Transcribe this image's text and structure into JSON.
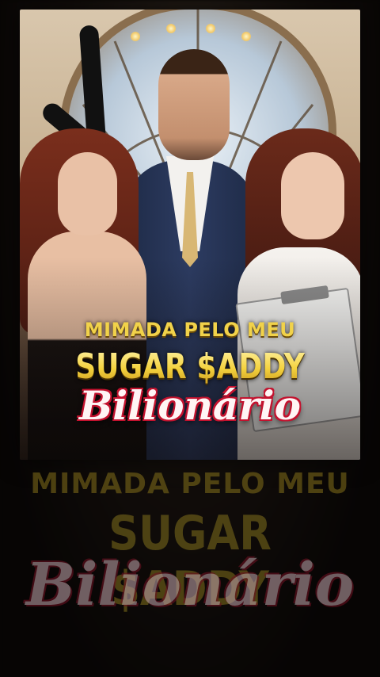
{
  "poster": {
    "title_line1": "MIMADA PELO MEU",
    "title_line2": "SUGAR $ADDY",
    "title_line3": "Bilionário"
  },
  "background_echo": {
    "line1": "MIMADA PELO MEU",
    "line2": "SUGAR $ADDY",
    "line3": "Bilionário"
  },
  "colors": {
    "title_gold": "#f1d24a",
    "title_red": "#c3122e"
  }
}
